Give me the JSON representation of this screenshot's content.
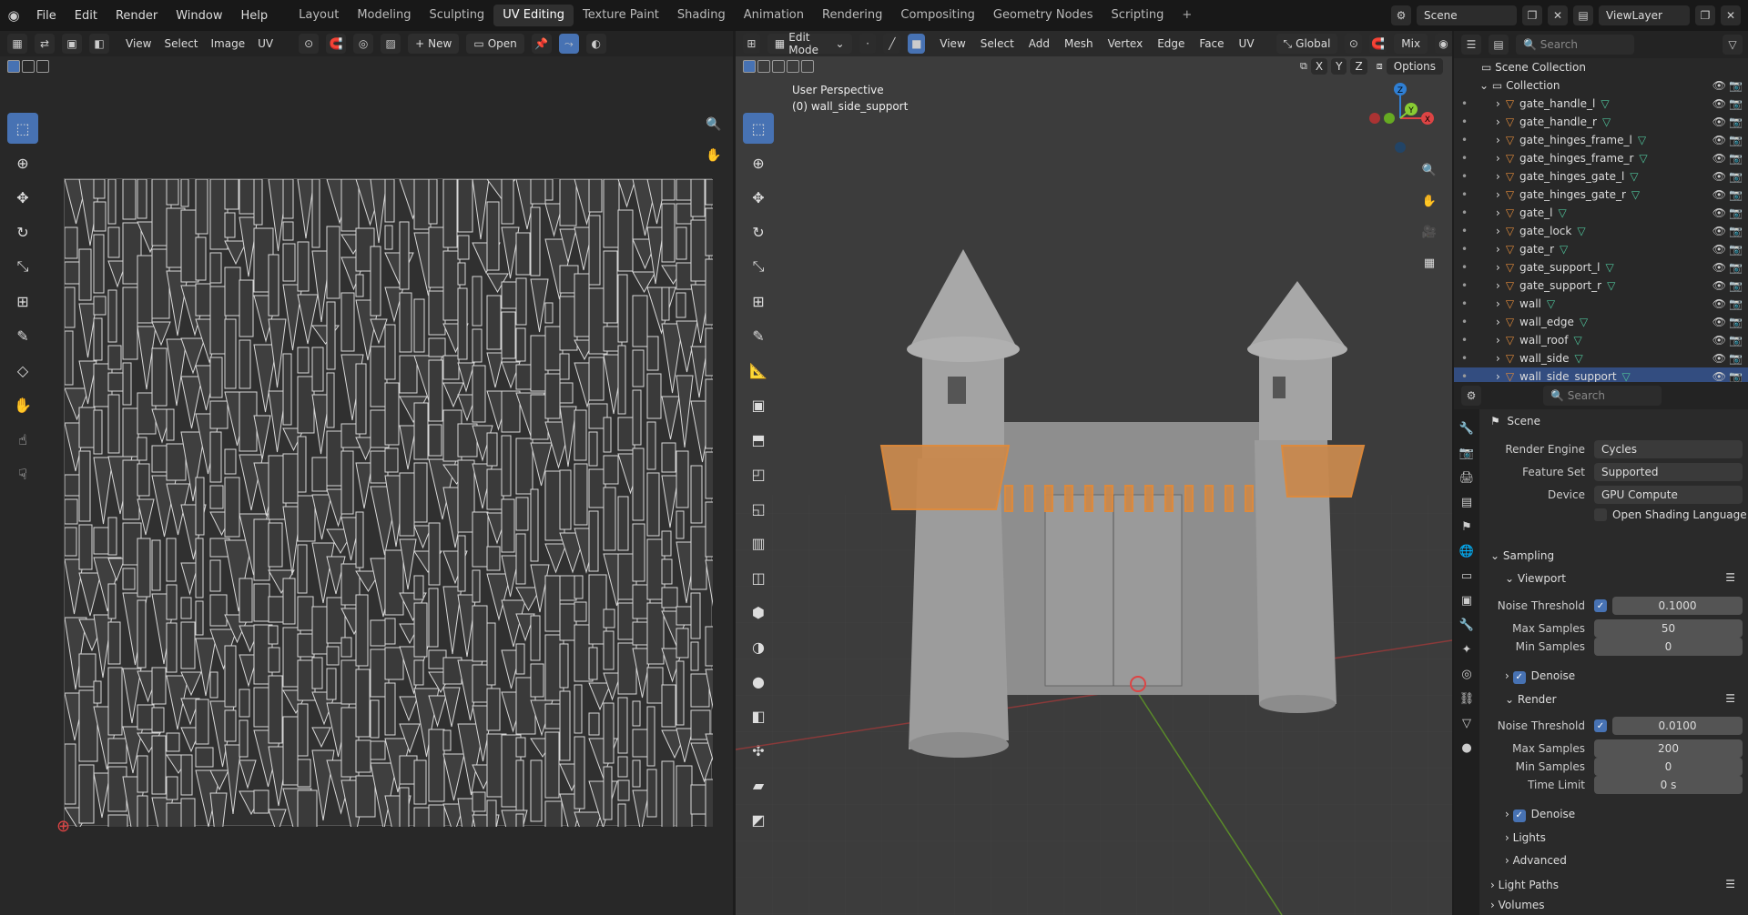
{
  "topbar": {
    "menus": [
      "File",
      "Edit",
      "Render",
      "Window",
      "Help"
    ],
    "workspaces": [
      "Layout",
      "Modeling",
      "Sculpting",
      "UV Editing",
      "Texture Paint",
      "Shading",
      "Animation",
      "Rendering",
      "Compositing",
      "Geometry Nodes",
      "Scripting"
    ],
    "active_workspace": "UV Editing",
    "add_workspace": "+",
    "scene": "Scene",
    "view_layer": "ViewLayer"
  },
  "uv_editor": {
    "menus": [
      "View",
      "Select",
      "Image",
      "UV"
    ],
    "new_label": "New",
    "open_label": "Open"
  },
  "viewport": {
    "mode": "Edit Mode",
    "menus": [
      "View",
      "Select",
      "Add",
      "Mesh",
      "Vertex",
      "Edge",
      "Face",
      "UV"
    ],
    "transform_orientation": "Global",
    "shading_mix": "Mix",
    "options": "Options",
    "perspective_label": "User Perspective",
    "object_label": "(0) wall_side_support",
    "axes": {
      "x": "X",
      "y": "Y",
      "z": "Z"
    },
    "xyz_buttons": [
      "X",
      "Y",
      "Z"
    ]
  },
  "outliner": {
    "search_placeholder": "Search",
    "scene_collection": "Scene Collection",
    "collection": "Collection",
    "items": [
      {
        "name": "gate_handle_l"
      },
      {
        "name": "gate_handle_r"
      },
      {
        "name": "gate_hinges_frame_l"
      },
      {
        "name": "gate_hinges_frame_r"
      },
      {
        "name": "gate_hinges_gate_l"
      },
      {
        "name": "gate_hinges_gate_r"
      },
      {
        "name": "gate_l"
      },
      {
        "name": "gate_lock"
      },
      {
        "name": "gate_r"
      },
      {
        "name": "gate_support_l"
      },
      {
        "name": "gate_support_r"
      },
      {
        "name": "wall"
      },
      {
        "name": "wall_edge"
      },
      {
        "name": "wall_roof"
      },
      {
        "name": "wall_side"
      },
      {
        "name": "wall_side_support"
      }
    ],
    "selected": "wall_side_support"
  },
  "properties": {
    "search_placeholder": "Search",
    "context": "Scene",
    "render_engine_label": "Render Engine",
    "render_engine": "Cycles",
    "feature_set_label": "Feature Set",
    "feature_set": "Supported",
    "device_label": "Device",
    "device": "GPU Compute",
    "osl_label": "Open Shading Language",
    "sampling": "Sampling",
    "viewport_section": "Viewport",
    "vp_noise_label": "Noise Threshold",
    "vp_noise": "0.1000",
    "vp_max_label": "Max Samples",
    "vp_max": "50",
    "vp_min_label": "Min Samples",
    "vp_min": "0",
    "vp_denoise": "Denoise",
    "render_section": "Render",
    "r_noise_label": "Noise Threshold",
    "r_noise": "0.0100",
    "r_max_label": "Max Samples",
    "r_max": "200",
    "r_min_label": "Min Samples",
    "r_min": "0",
    "r_time_label": "Time Limit",
    "r_time": "0 s",
    "r_denoise": "Denoise",
    "lights": "Lights",
    "advanced": "Advanced",
    "light_paths": "Light Paths",
    "volumes": "Volumes"
  },
  "colors": {
    "accent": "#4772b3",
    "selection": "#e08a3a",
    "selected_row": "#334d80"
  }
}
